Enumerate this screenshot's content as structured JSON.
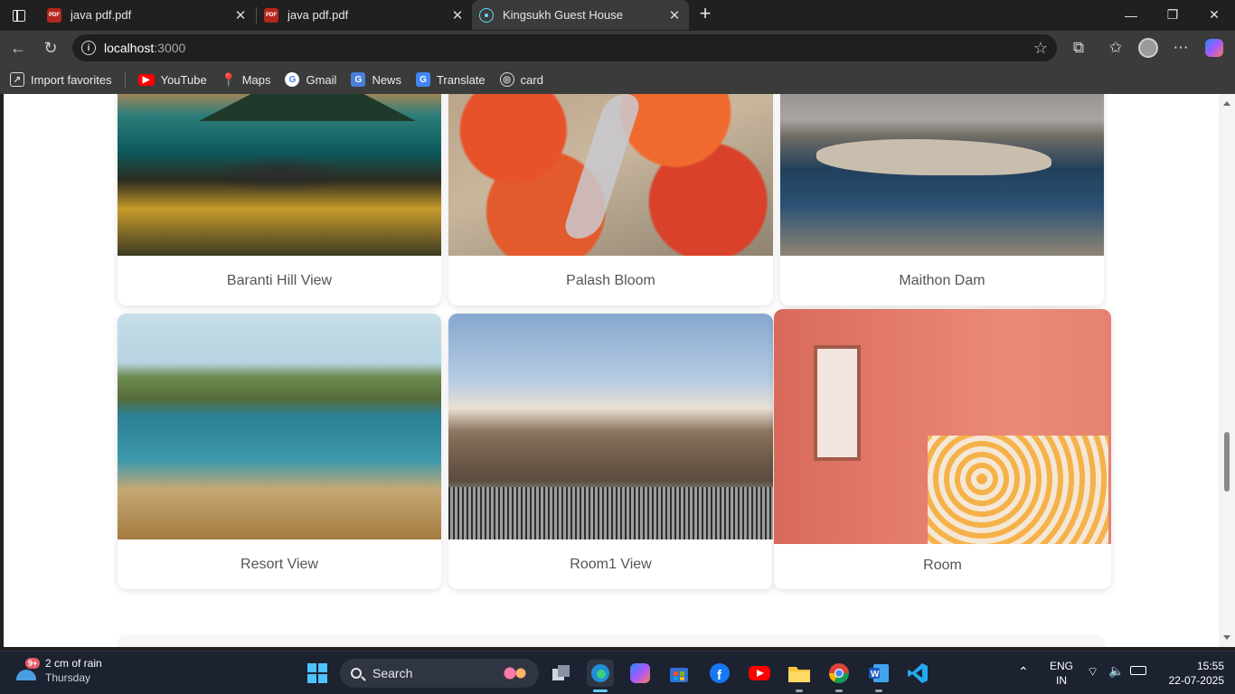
{
  "browser": {
    "tabs": [
      {
        "title": "java pdf.pdf",
        "favicon": "pdf-icon",
        "active": false
      },
      {
        "title": "java pdf.pdf",
        "favicon": "pdf-icon",
        "active": false
      },
      {
        "title": "Kingsukh Guest House",
        "favicon": "react-icon",
        "active": true
      }
    ],
    "pdf_badge": "PDF",
    "url_host": "localhost",
    "url_port": ":3000",
    "favorites": [
      {
        "label": "Import favorites",
        "icon": "import-icon"
      },
      {
        "label": "YouTube",
        "icon": "youtube-icon"
      },
      {
        "label": "Maps",
        "icon": "maps-icon"
      },
      {
        "label": "Gmail",
        "icon": "google-icon"
      },
      {
        "label": "News",
        "icon": "news-icon"
      },
      {
        "label": "Translate",
        "icon": "translate-icon"
      },
      {
        "label": "card",
        "icon": "globe-icon"
      }
    ]
  },
  "gallery": {
    "cards": [
      {
        "caption": "Baranti Hill View"
      },
      {
        "caption": "Palash Bloom"
      },
      {
        "caption": "Maithon Dam"
      },
      {
        "caption": "Resort View"
      },
      {
        "caption": "Room1 View"
      },
      {
        "caption": "Room"
      }
    ]
  },
  "taskbar": {
    "weather_title": "2 cm of rain",
    "weather_day": "Thursday",
    "weather_badge": "9+",
    "search_label": "Search",
    "lang_line1": "ENG",
    "lang_line2": "IN",
    "time": "15:55",
    "date": "22-07-2025"
  },
  "colors": {
    "browser_frame": "#202020",
    "toolbar": "#3b3b3b",
    "taskbar": "#1c2230",
    "accent": "#60cdff"
  }
}
